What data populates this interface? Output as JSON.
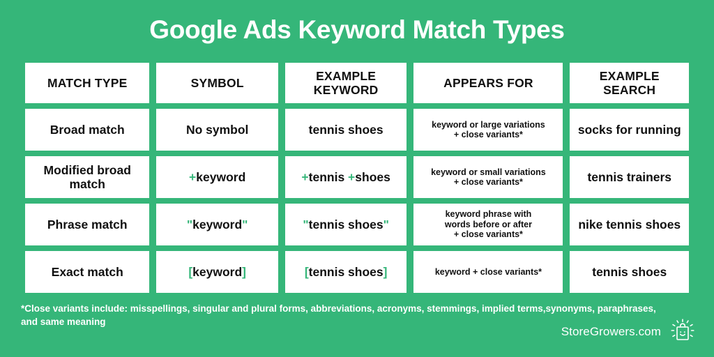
{
  "title": "Google Ads Keyword Match Types",
  "theme": {
    "background": "#35b679",
    "accent": "#35b679",
    "cell_background": "#ffffff",
    "text": "#111111",
    "title_color": "#ffffff"
  },
  "table": {
    "headers": [
      "MATCH TYPE",
      "SYMBOL",
      "EXAMPLE KEYWORD",
      "APPEARS FOR",
      "EXAMPLE SEARCH"
    ],
    "header_lines": [
      [
        "MATCH TYPE"
      ],
      [
        "SYMBOL"
      ],
      [
        "EXAMPLE",
        "KEYWORD"
      ],
      [
        "APPEARS FOR"
      ],
      [
        "EXAMPLE",
        "SEARCH"
      ]
    ],
    "rows": [
      {
        "match_type": "Broad match",
        "symbol": "No symbol",
        "symbol_parts": [
          {
            "text": "No symbol",
            "accent": false
          }
        ],
        "example_keyword": "tennis shoes",
        "example_keyword_parts": [
          {
            "text": "tennis shoes",
            "accent": false
          }
        ],
        "appears_for": "keyword or large variations + close variants*",
        "appears_for_lines": [
          "keyword or large variations",
          "+ close variants*"
        ],
        "example_search": "socks for running"
      },
      {
        "match_type": "Modified broad match",
        "match_type_lines": [
          "Modified broad",
          "match"
        ],
        "symbol": "+keyword",
        "symbol_parts": [
          {
            "text": "+",
            "accent": true
          },
          {
            "text": "keyword",
            "accent": false
          }
        ],
        "example_keyword": "+tennis +shoes",
        "example_keyword_parts": [
          {
            "text": "+",
            "accent": true
          },
          {
            "text": "tennis ",
            "accent": false
          },
          {
            "text": "+",
            "accent": true
          },
          {
            "text": "shoes",
            "accent": false
          }
        ],
        "appears_for": "keyword or small variations + close variants*",
        "appears_for_lines": [
          "keyword or small variations",
          "+ close variants*"
        ],
        "example_search": "tennis trainers"
      },
      {
        "match_type": "Phrase match",
        "symbol": "\"keyword\"",
        "symbol_parts": [
          {
            "text": "\"",
            "accent": true
          },
          {
            "text": "keyword",
            "accent": false
          },
          {
            "text": "\"",
            "accent": true
          }
        ],
        "example_keyword": "\"tennis shoes\"",
        "example_keyword_parts": [
          {
            "text": "\"",
            "accent": true
          },
          {
            "text": "tennis shoes",
            "accent": false
          },
          {
            "text": "\"",
            "accent": true
          }
        ],
        "appears_for": "keyword phrase with words before or after + close variants*",
        "appears_for_lines": [
          "keyword phrase with",
          "words before or after",
          "+ close variants*"
        ],
        "example_search": "nike tennis shoes"
      },
      {
        "match_type": "Exact match",
        "symbol": "[keyword]",
        "symbol_parts": [
          {
            "text": "[",
            "accent": true
          },
          {
            "text": "keyword",
            "accent": false
          },
          {
            "text": "]",
            "accent": true
          }
        ],
        "example_keyword": "[tennis shoes]",
        "example_keyword_parts": [
          {
            "text": "[",
            "accent": true
          },
          {
            "text": "tennis shoes",
            "accent": false
          },
          {
            "text": "]",
            "accent": true
          }
        ],
        "appears_for": "keyword + close variants*",
        "appears_for_lines": [
          "keyword + close variants*"
        ],
        "example_search": "tennis shoes"
      }
    ]
  },
  "footnote": {
    "lines": [
      "*Close variants include: misspellings, singular and plural forms, abbreviations, acronyms, stemmings, implied terms,",
      "synonyms, paraphrases, and same meaning"
    ],
    "text": "*Close variants include: misspellings, singular and plural forms, abbreviations, acronyms, stemmings, implied terms, synonyms, paraphrases, and same meaning"
  },
  "brand": {
    "name": "StoreGrowers.com",
    "icon": "smiling-shopping-bag-icon"
  }
}
